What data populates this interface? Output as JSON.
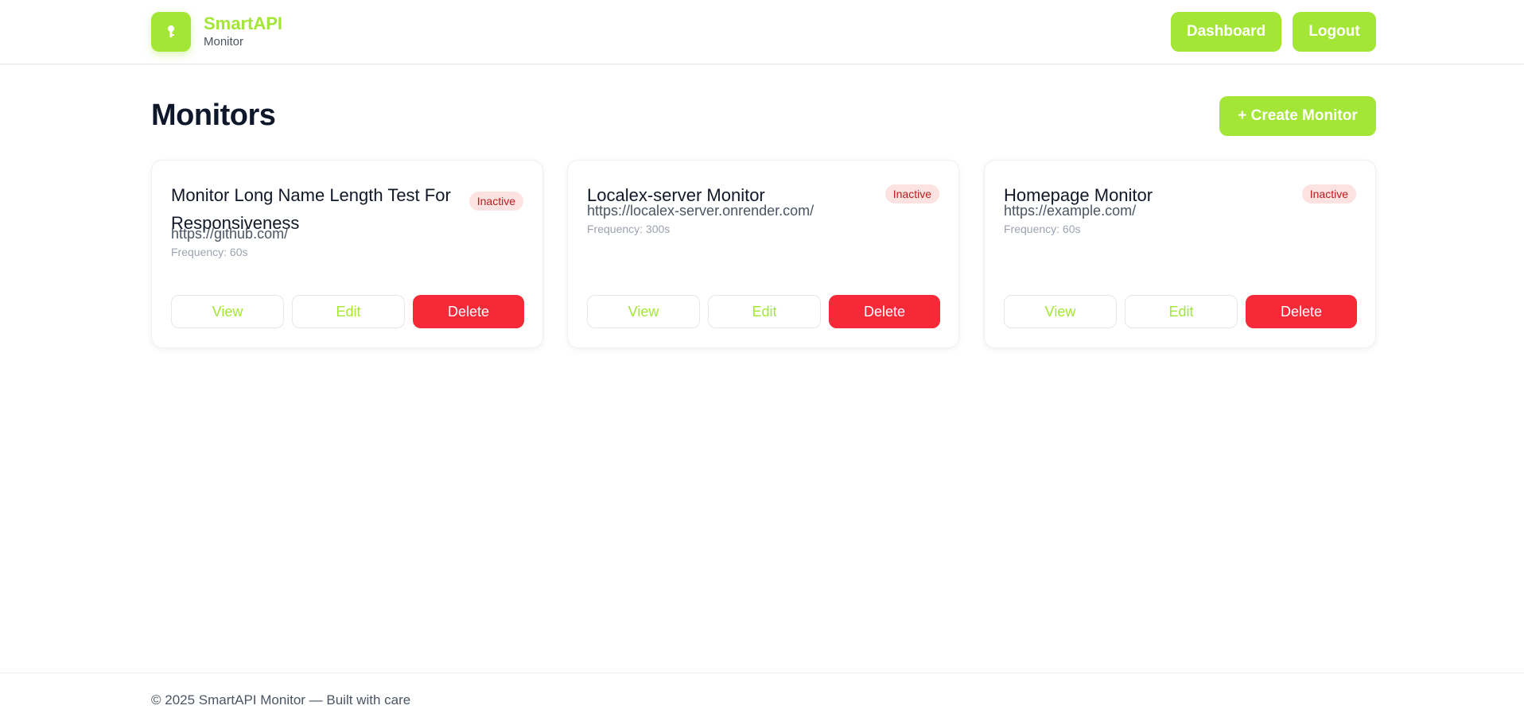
{
  "header": {
    "brand_name": "SmartAPI",
    "brand_sub": "Monitor",
    "logo_icon": "key-icon",
    "nav": [
      {
        "label": "Dashboard"
      },
      {
        "label": "Logout"
      }
    ]
  },
  "main": {
    "title": "Monitors",
    "create_label": "+ Create Monitor",
    "monitors": [
      {
        "name": "Monitor Long Name Length Test For Responsiveness",
        "status": "Inactive",
        "url": "https://github.com/",
        "frequency": "Frequency: 60s",
        "actions": {
          "view": "View",
          "edit": "Edit",
          "delete": "Delete"
        }
      },
      {
        "name": "Localex-server Monitor",
        "status": "Inactive",
        "url": "https://localex-server.onrender.com/",
        "frequency": "Frequency: 300s",
        "actions": {
          "view": "View",
          "edit": "Edit",
          "delete": "Delete"
        }
      },
      {
        "name": "Homepage Monitor",
        "status": "Inactive",
        "url": "https://example.com/",
        "frequency": "Frequency: 60s",
        "actions": {
          "view": "View",
          "edit": "Edit",
          "delete": "Delete"
        }
      }
    ]
  },
  "footer": {
    "text": "© 2025 SmartAPI Monitor — Built with care"
  },
  "colors": {
    "accent": "#a3e635",
    "danger": "#f52938",
    "badge_bg": "#fde2e2",
    "badge_text": "#b91c1c"
  }
}
